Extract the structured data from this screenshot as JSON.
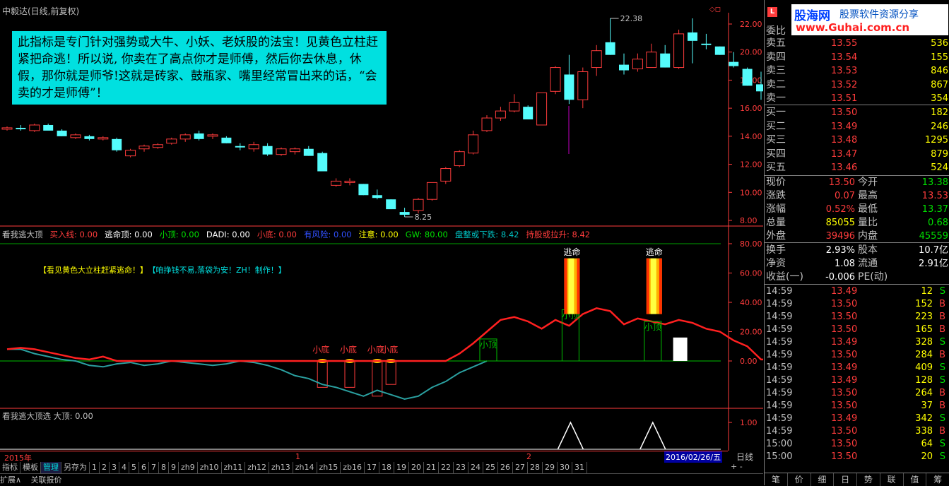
{
  "window_title": "中毅达(日线,前复权)",
  "annotation_text": "此指标是专门针对强势或大牛、小妖、老妖股的法宝！见黄色立柱赶紧把命逃！所以说, 你卖在了高点你才是师傅，然后你去休息，休假，那你就是师爷!这就是砖家、鼓瓶家、嘴里经常冒出来的话，“会卖的才是师傅”！",
  "price_axis": [
    "22.00",
    "20.00",
    "18.00",
    "16.00",
    "14.00",
    "12.00",
    "10.00",
    "8.00"
  ],
  "high_label": "22.38",
  "low_label": "8.25",
  "indicator": {
    "name": "看我逃大顶",
    "items": [
      {
        "label": "买入线: 0.00",
        "color": "#ff3c3c"
      },
      {
        "label": "逃命顶: 0.00",
        "color": "#ffffff"
      },
      {
        "label": "小顶: 0.00",
        "color": "#00e000"
      },
      {
        "label": "DADI: 0.00",
        "color": "#ffffff"
      },
      {
        "label": "小底: 0.00",
        "color": "#ff3c3c"
      },
      {
        "label": "有风险: 0.00",
        "color": "#3050ff"
      },
      {
        "label": "注意: 0.00",
        "color": "#ffff00"
      },
      {
        "label": "GW: 80.00",
        "color": "#00e000"
      },
      {
        "label": "盘整或下跌: 8.42",
        "color": "#00c0c0"
      },
      {
        "label": "持股或拉升: 8.42",
        "color": "#ff3c3c"
      }
    ],
    "messages": [
      {
        "text": "【看见黄色大立柱赶紧逃命！】",
        "color": "#ffff00"
      },
      {
        "text": "【咱挣钱不易,落袋为安！ZH！制作！】",
        "color": "#00e0e0"
      }
    ],
    "axis": [
      "80.00",
      "60.00",
      "40.00",
      "20.00",
      "0.00"
    ],
    "labels": {
      "escape": "逃命",
      "small_top": "小顶",
      "small_bottom": "小底"
    }
  },
  "panel3": {
    "title": "看我逃大顶选  大顶: 0.00",
    "axis": [
      "1.00"
    ]
  },
  "time_axis": {
    "year": "2015年",
    "m1": "1",
    "m2": "2",
    "date": "2016/02/26/五",
    "period": "日线"
  },
  "bottom_tabs": [
    "指标",
    "模板",
    "管理",
    "另存为",
    "1",
    "2",
    "3",
    "4",
    "5",
    "6",
    "7",
    "8",
    "9",
    "zh9",
    "zh10",
    "zh11",
    "zh12",
    "zh13",
    "zh14",
    "zh15",
    "zb16",
    "17",
    "18",
    "19",
    "20",
    "21",
    "22",
    "23",
    "24",
    "25",
    "26",
    "27",
    "28",
    "29",
    "30",
    "31"
  ],
  "status": [
    "扩展∧",
    "关联报价"
  ],
  "quote": {
    "header_label": "委比",
    "asks": [
      {
        "label": "卖五",
        "price": "13.55",
        "vol": "536"
      },
      {
        "label": "卖四",
        "price": "13.54",
        "vol": "155"
      },
      {
        "label": "卖三",
        "price": "13.53",
        "vol": "846"
      },
      {
        "label": "卖二",
        "price": "13.52",
        "vol": "867"
      },
      {
        "label": "卖一",
        "price": "13.51",
        "vol": "354"
      }
    ],
    "bids": [
      {
        "label": "买一",
        "price": "13.50",
        "vol": "182"
      },
      {
        "label": "买二",
        "price": "13.49",
        "vol": "246"
      },
      {
        "label": "买三",
        "price": "13.48",
        "vol": "1295"
      },
      {
        "label": "买四",
        "price": "13.47",
        "vol": "879"
      },
      {
        "label": "买五",
        "price": "13.46",
        "vol": "524"
      }
    ],
    "info": [
      {
        "k1": "现价",
        "v1": "13.50",
        "c1": "#ff3c3c",
        "k2": "今开",
        "v2": "13.38",
        "c2": "#00e000"
      },
      {
        "k1": "涨跌",
        "v1": "0.07",
        "c1": "#ff3c3c",
        "k2": "最高",
        "v2": "13.53",
        "c2": "#ff3c3c"
      },
      {
        "k1": "涨幅",
        "v1": "0.52%",
        "c1": "#ff3c3c",
        "k2": "最低",
        "v2": "13.37",
        "c2": "#00e000"
      },
      {
        "k1": "总量",
        "v1": "85055",
        "c1": "#ffff00",
        "k2": "量比",
        "v2": "0.68",
        "c2": "#00e000"
      },
      {
        "k1": "外盘",
        "v1": "39496",
        "c1": "#ff3c3c",
        "k2": "内盘",
        "v2": "45559",
        "c2": "#00e000"
      }
    ],
    "info2": [
      {
        "k1": "换手",
        "v1": "2.93%",
        "c1": "#ffffff",
        "k2": "股本",
        "v2": "10.7亿",
        "c2": "#ffffff"
      },
      {
        "k1": "净资",
        "v1": "1.08",
        "c1": "#ffffff",
        "k2": "流通",
        "v2": "2.91亿",
        "c2": "#ffffff"
      },
      {
        "k1": "收益(一)",
        "v1": "-0.006",
        "c1": "#ffffff",
        "k2": "PE(动)",
        "v2": "",
        "c2": "#ffffff"
      }
    ],
    "ticks": [
      {
        "t": "14:59",
        "p": "13.49",
        "v": "12",
        "s": "S"
      },
      {
        "t": "14:59",
        "p": "13.50",
        "v": "152",
        "s": "B"
      },
      {
        "t": "14:59",
        "p": "13.50",
        "v": "223",
        "s": "B"
      },
      {
        "t": "14:59",
        "p": "13.50",
        "v": "165",
        "s": "B"
      },
      {
        "t": "14:59",
        "p": "13.49",
        "v": "328",
        "s": "S"
      },
      {
        "t": "14:59",
        "p": "13.50",
        "v": "284",
        "s": "B"
      },
      {
        "t": "14:59",
        "p": "13.49",
        "v": "409",
        "s": "S"
      },
      {
        "t": "14:59",
        "p": "13.49",
        "v": "128",
        "s": "S"
      },
      {
        "t": "14:59",
        "p": "13.50",
        "v": "264",
        "s": "B"
      },
      {
        "t": "14:59",
        "p": "13.50",
        "v": "37",
        "s": "B"
      },
      {
        "t": "14:59",
        "p": "13.49",
        "v": "342",
        "s": "S"
      },
      {
        "t": "14:59",
        "p": "13.50",
        "v": "338",
        "s": "B"
      },
      {
        "t": "15:00",
        "p": "13.50",
        "v": "64",
        "s": "S"
      },
      {
        "t": "15:00",
        "p": "13.50",
        "v": "20",
        "s": "S"
      }
    ],
    "tabs": [
      "笔",
      "价",
      "细",
      "日",
      "势",
      "联",
      "值",
      "筹"
    ]
  },
  "logo": {
    "brand": "股海网",
    "slogan": "股票软件资源分享",
    "url": "www.Guhai.com.cn"
  },
  "candles": [
    [
      14.5,
      14.7,
      14.4,
      14.6
    ],
    [
      14.6,
      14.8,
      14.4,
      14.5
    ],
    [
      14.4,
      14.9,
      14.3,
      14.8
    ],
    [
      14.8,
      14.9,
      14.5,
      14.4
    ],
    [
      14.4,
      14.5,
      14.0,
      14.0
    ],
    [
      13.9,
      14.2,
      13.8,
      14.1
    ],
    [
      14.0,
      14.1,
      13.7,
      13.8
    ],
    [
      13.8,
      14.0,
      13.7,
      13.9
    ],
    [
      13.8,
      13.9,
      12.9,
      13.0
    ],
    [
      12.6,
      13.1,
      12.5,
      13.0
    ],
    [
      13.1,
      13.4,
      12.9,
      13.3
    ],
    [
      13.2,
      13.5,
      13.1,
      13.4
    ],
    [
      13.5,
      13.9,
      13.4,
      13.8
    ],
    [
      13.8,
      14.2,
      13.6,
      14.1
    ],
    [
      14.2,
      14.4,
      13.7,
      13.8
    ],
    [
      14.0,
      14.2,
      13.8,
      14.1
    ],
    [
      13.9,
      14.0,
      13.5,
      13.5
    ],
    [
      13.3,
      13.5,
      13.0,
      13.2
    ],
    [
      13.1,
      13.6,
      12.9,
      13.4
    ],
    [
      13.3,
      13.5,
      12.6,
      12.7
    ],
    [
      12.7,
      13.2,
      12.6,
      13.1
    ],
    [
      12.9,
      13.2,
      12.7,
      13.1
    ],
    [
      13.1,
      13.3,
      12.6,
      12.6
    ],
    [
      12.8,
      12.9,
      11.5,
      11.5
    ],
    [
      10.5,
      11.0,
      10.4,
      10.8
    ],
    [
      10.7,
      11.0,
      10.5,
      10.8
    ],
    [
      10.6,
      10.6,
      9.8,
      9.8
    ],
    [
      9.8,
      10.2,
      9.5,
      9.6
    ],
    [
      9.5,
      9.5,
      8.8,
      8.8
    ],
    [
      8.6,
      8.9,
      8.25,
      8.4
    ],
    [
      8.7,
      9.6,
      8.5,
      9.5
    ],
    [
      9.5,
      10.7,
      9.4,
      10.7
    ],
    [
      10.8,
      11.8,
      10.6,
      11.7
    ],
    [
      11.9,
      13.0,
      11.8,
      12.9
    ],
    [
      12.8,
      14.4,
      12.7,
      14.1
    ],
    [
      14.4,
      15.5,
      14.3,
      15.3
    ],
    [
      15.3,
      16.1,
      15.1,
      15.8
    ],
    [
      15.8,
      17.0,
      15.7,
      16.4
    ],
    [
      16.1,
      16.2,
      15.2,
      15.2
    ],
    [
      14.8,
      17.1,
      14.8,
      17.1
    ],
    [
      17.2,
      19.0,
      17.0,
      18.9
    ],
    [
      18.4,
      19.8,
      16.3,
      16.6
    ],
    [
      16.6,
      18.9,
      16.0,
      18.6
    ],
    [
      18.9,
      20.5,
      18.3,
      20.1
    ],
    [
      20.7,
      22.4,
      19.8,
      19.8
    ],
    [
      19.1,
      19.9,
      18.4,
      18.7
    ],
    [
      18.8,
      19.9,
      18.6,
      19.5
    ],
    [
      18.9,
      20.6,
      18.9,
      20.0
    ],
    [
      19.9,
      20.5,
      18.9,
      18.9
    ],
    [
      18.9,
      21.6,
      18.8,
      21.3
    ],
    [
      21.4,
      22.4,
      19.2,
      20.8
    ],
    [
      20.6,
      21.3,
      20.2,
      20.5
    ],
    [
      20.4,
      20.4,
      19.8,
      19.8
    ],
    [
      19.3,
      20.0,
      18.9,
      19.0
    ],
    [
      18.8,
      18.9,
      17.6,
      17.6
    ],
    [
      17.7,
      18.6,
      16.6,
      17.2
    ]
  ],
  "indicator_series": {
    "red_line": [
      8,
      9,
      8,
      6,
      4,
      2,
      1,
      3,
      0,
      0,
      0,
      0,
      0,
      0,
      0,
      0,
      0,
      0,
      0,
      0,
      0,
      0,
      0,
      0,
      0,
      0,
      0,
      0,
      0,
      0,
      0,
      0,
      0,
      5,
      12,
      20,
      28,
      30,
      27,
      22,
      28,
      24,
      32,
      36,
      34,
      25,
      29,
      27,
      25,
      28,
      26,
      22,
      20,
      14,
      10,
      1,
      1
    ],
    "teal_line": [
      8,
      8,
      5,
      3,
      1,
      0,
      -3,
      -4,
      -2,
      -1,
      -3,
      -2,
      0,
      -1,
      -2,
      -3,
      -2,
      0,
      -1,
      -3,
      -6,
      -10,
      -12,
      -16,
      -18,
      -21,
      -24,
      -20,
      -23,
      -26,
      -24,
      -18,
      -14,
      -8,
      -4,
      0
    ]
  }
}
